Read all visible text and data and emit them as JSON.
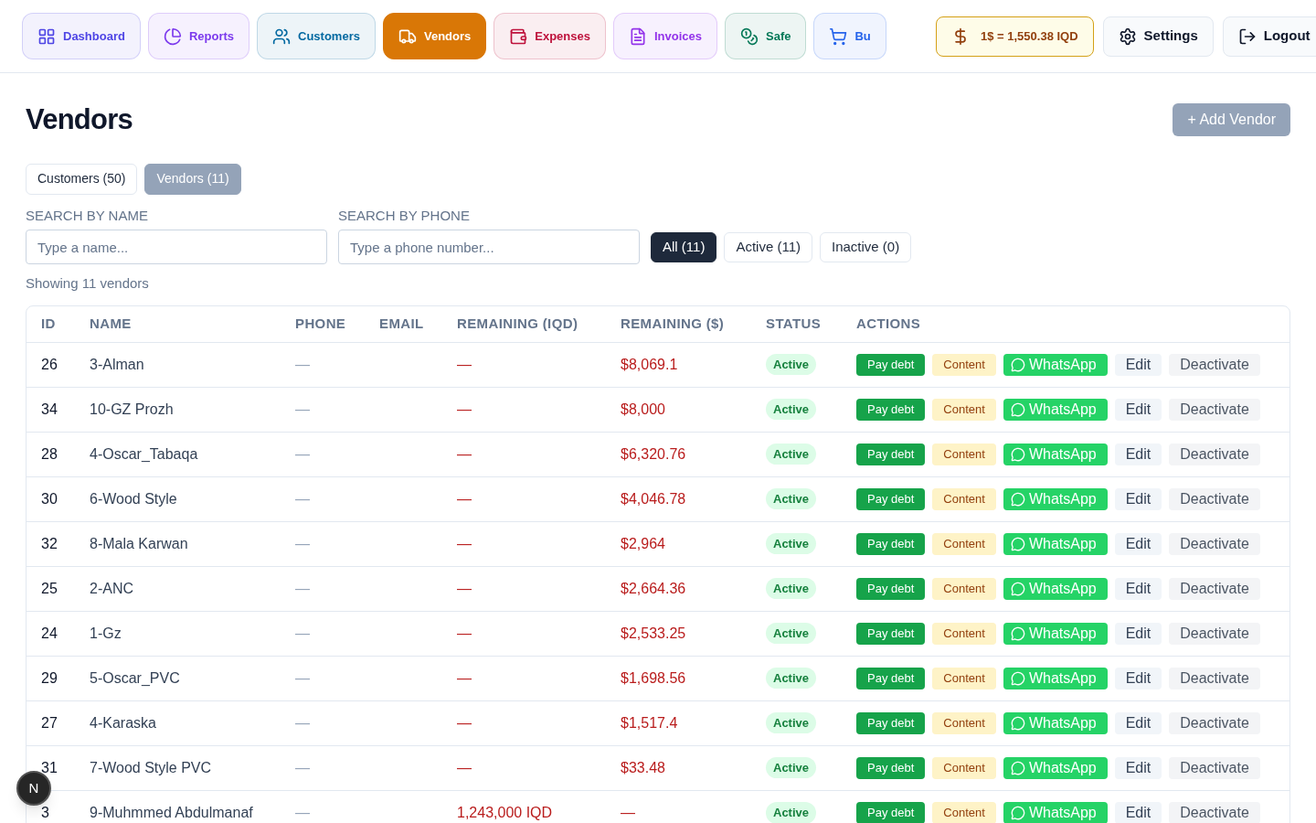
{
  "nav": [
    {
      "label": "Dashboard",
      "color": "#4f46e5",
      "selected": false
    },
    {
      "label": "Reports",
      "color": "#7c3aed",
      "selected": false
    },
    {
      "label": "Customers",
      "color": "#0369a1",
      "selected": false
    },
    {
      "label": "Vendors",
      "color": "#d97706",
      "selected": true
    },
    {
      "label": "Expenses",
      "color": "#be123c",
      "selected": false
    },
    {
      "label": "Invoices",
      "color": "#9333ea",
      "selected": false
    },
    {
      "label": "Safe",
      "color": "#047857",
      "selected": false
    },
    {
      "label": "Bu",
      "color": "#2563eb",
      "selected": false
    }
  ],
  "rate": "1$ = 1,550.38 IQD",
  "settings": "Settings",
  "logout": "Logout",
  "title": "Vendors",
  "add_button": "+ Add Vendor",
  "segments": [
    {
      "label": "Customers (50)",
      "selected": false
    },
    {
      "label": "Vendors (11)",
      "selected": true
    }
  ],
  "search_name": {
    "label": "SEARCH BY NAME",
    "placeholder": "Type a name..."
  },
  "search_phone": {
    "label": "SEARCH BY PHONE",
    "placeholder": "Type a phone number..."
  },
  "filters": [
    {
      "label": "All (11)",
      "selected": true
    },
    {
      "label": "Active (11)",
      "selected": false
    },
    {
      "label": "Inactive (0)",
      "selected": false
    }
  ],
  "showing": "Showing 11 vendors",
  "table": {
    "columns": [
      "ID",
      "NAME",
      "PHONE",
      "EMAIL",
      "REMAINING (IQD)",
      "REMAINING ($)",
      "STATUS",
      "ACTIONS"
    ],
    "rows": [
      {
        "id": "26",
        "name": "3-Alman",
        "phone": "—",
        "remaining_iqd": "—",
        "remaining_usd": "$8,069.1",
        "status": "Active",
        "actions": [
          {
            "kind": "pay",
            "label": "Pay debt"
          },
          {
            "kind": "content",
            "label": "Content"
          },
          {
            "kind": "whatsapp",
            "label": "WhatsApp"
          },
          {
            "kind": "edit",
            "label": "Edit"
          },
          {
            "kind": "deactivate",
            "label": "Deactivate"
          }
        ]
      },
      {
        "id": "34",
        "name": "10-GZ Prozh",
        "phone": "—",
        "remaining_iqd": "—",
        "remaining_usd": "$8,000",
        "status": "Active",
        "actions": [
          {
            "kind": "pay",
            "label": "Pay debt"
          },
          {
            "kind": "content",
            "label": "Content"
          },
          {
            "kind": "whatsapp",
            "label": "WhatsApp"
          },
          {
            "kind": "edit",
            "label": "Edit"
          },
          {
            "kind": "deactivate",
            "label": "Deactivate"
          }
        ]
      },
      {
        "id": "28",
        "name": "4-Oscar_Tabaqa",
        "phone": "—",
        "remaining_iqd": "—",
        "remaining_usd": "$6,320.76",
        "status": "Active",
        "actions": [
          {
            "kind": "pay",
            "label": "Pay debt"
          },
          {
            "kind": "content",
            "label": "Content"
          },
          {
            "kind": "whatsapp",
            "label": "WhatsApp"
          },
          {
            "kind": "edit",
            "label": "Edit"
          },
          {
            "kind": "deactivate",
            "label": "Deactivate"
          }
        ]
      },
      {
        "id": "30",
        "name": "6-Wood Style",
        "phone": "—",
        "remaining_iqd": "—",
        "remaining_usd": "$4,046.78",
        "status": "Active",
        "actions": [
          {
            "kind": "pay",
            "label": "Pay debt"
          },
          {
            "kind": "content",
            "label": "Content"
          },
          {
            "kind": "whatsapp",
            "label": "WhatsApp"
          },
          {
            "kind": "edit",
            "label": "Edit"
          },
          {
            "kind": "deactivate",
            "label": "Deactivate"
          }
        ]
      },
      {
        "id": "32",
        "name": "8-Mala Karwan",
        "phone": "—",
        "remaining_iqd": "—",
        "remaining_usd": "$2,964",
        "status": "Active",
        "actions": [
          {
            "kind": "pay",
            "label": "Pay debt"
          },
          {
            "kind": "content",
            "label": "Content"
          },
          {
            "kind": "whatsapp",
            "label": "WhatsApp"
          },
          {
            "kind": "edit",
            "label": "Edit"
          },
          {
            "kind": "deactivate",
            "label": "Deactivate"
          }
        ]
      },
      {
        "id": "25",
        "name": "2-ANC",
        "phone": "—",
        "remaining_iqd": "—",
        "remaining_usd": "$2,664.36",
        "status": "Active",
        "actions": [
          {
            "kind": "pay",
            "label": "Pay debt"
          },
          {
            "kind": "content",
            "label": "Content"
          },
          {
            "kind": "whatsapp",
            "label": "WhatsApp"
          },
          {
            "kind": "edit",
            "label": "Edit"
          },
          {
            "kind": "deactivate",
            "label": "Deactivate"
          }
        ]
      },
      {
        "id": "24",
        "name": "1-Gz",
        "phone": "—",
        "remaining_iqd": "—",
        "remaining_usd": "$2,533.25",
        "status": "Active",
        "actions": [
          {
            "kind": "pay",
            "label": "Pay debt"
          },
          {
            "kind": "content",
            "label": "Content"
          },
          {
            "kind": "whatsapp",
            "label": "WhatsApp"
          },
          {
            "kind": "edit",
            "label": "Edit"
          },
          {
            "kind": "deactivate",
            "label": "Deactivate"
          }
        ]
      },
      {
        "id": "29",
        "name": "5-Oscar_PVC",
        "phone": "—",
        "remaining_iqd": "—",
        "remaining_usd": "$1,698.56",
        "status": "Active",
        "actions": [
          {
            "kind": "pay",
            "label": "Pay debt"
          },
          {
            "kind": "content",
            "label": "Content"
          },
          {
            "kind": "whatsapp",
            "label": "WhatsApp"
          },
          {
            "kind": "edit",
            "label": "Edit"
          },
          {
            "kind": "deactivate",
            "label": "Deactivate"
          }
        ]
      },
      {
        "id": "27",
        "name": "4-Karaska",
        "phone": "—",
        "remaining_iqd": "—",
        "remaining_usd": "$1,517.4",
        "status": "Active",
        "actions": [
          {
            "kind": "pay",
            "label": "Pay debt"
          },
          {
            "kind": "content",
            "label": "Content"
          },
          {
            "kind": "whatsapp",
            "label": "WhatsApp"
          },
          {
            "kind": "edit",
            "label": "Edit"
          },
          {
            "kind": "deactivate",
            "label": "Deactivate"
          }
        ]
      },
      {
        "id": "31",
        "name": "7-Wood Style PVC",
        "phone": "—",
        "remaining_iqd": "—",
        "remaining_usd": "$33.48",
        "status": "Active",
        "actions": [
          {
            "kind": "pay",
            "label": "Pay debt"
          },
          {
            "kind": "content",
            "label": "Content"
          },
          {
            "kind": "whatsapp",
            "label": "WhatsApp"
          },
          {
            "kind": "edit",
            "label": "Edit"
          },
          {
            "kind": "deactivate",
            "label": "Deactivate"
          }
        ]
      },
      {
        "id": "3",
        "name": "9-Muhmmed Abdulmanaf",
        "phone": "—",
        "remaining_iqd": "1,243,000 IQD",
        "remaining_usd": "—",
        "status": "Active",
        "actions": [
          {
            "kind": "pay",
            "label": "Pay debt"
          },
          {
            "kind": "content",
            "label": "Content"
          },
          {
            "kind": "whatsapp",
            "label": "WhatsApp"
          },
          {
            "kind": "edit",
            "label": "Edit"
          },
          {
            "kind": "deactivate",
            "label": "Deactivate"
          }
        ]
      }
    ]
  },
  "dev_badge": "N"
}
